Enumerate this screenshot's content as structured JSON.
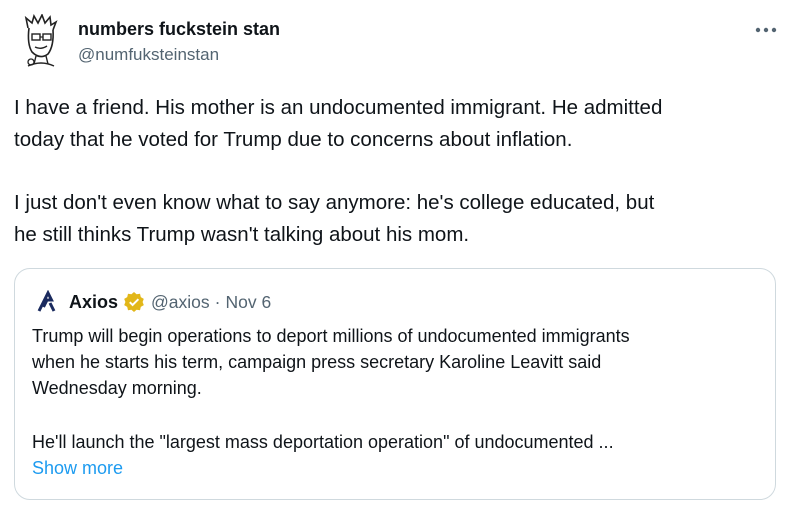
{
  "author": {
    "display_name": "numbers fuckstein stan",
    "handle": "@numfuksteinstan"
  },
  "tweet": {
    "lines": [
      "I have a friend. His mother is an undocumented immigrant. He admitted",
      "today that he voted for Trump due to concerns about inflation.",
      "I just don't even know what to say anymore: he's college educated, but",
      "he still thinks Trump wasn't talking about his mom."
    ]
  },
  "quote": {
    "name": "Axios",
    "handle": "@axios",
    "separator": "·",
    "date": "Nov 6",
    "lines": [
      "Trump will begin operations to deport millions of undocumented immigrants",
      "when he starts his term, campaign press secretary Karoline Leavitt said",
      "Wednesday morning.",
      "He'll launch the \"largest mass deportation operation\" of undocumented ..."
    ],
    "show_more": "Show more"
  },
  "icons": {
    "more": "more-horizontal-icon",
    "verified": "verified-badge-icon",
    "axios_logo": "axios-logo-icon"
  },
  "colors": {
    "text": "#0f1419",
    "secondary": "#536471",
    "link": "#1d9bf0",
    "verified_gold": "#e2b719",
    "border": "#cfd9de"
  }
}
